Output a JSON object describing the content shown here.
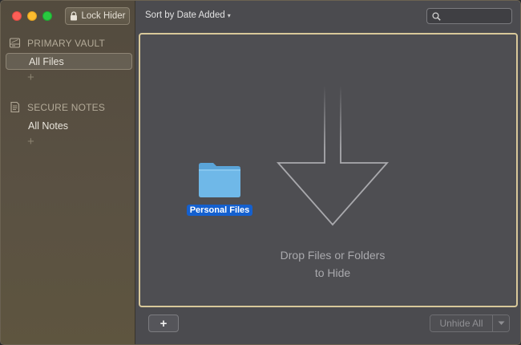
{
  "sidebar": {
    "lock_label": "Lock Hider",
    "sections": [
      {
        "title": "PRIMARY VAULT",
        "items": [
          "All Files"
        ],
        "icon": "drive-icon"
      },
      {
        "title": "SECURE NOTES",
        "items": [
          "All Notes"
        ],
        "icon": "notes-icon"
      }
    ],
    "add_symbol": "+"
  },
  "toolbar": {
    "sort_label": "Sort by Date Added",
    "sort_caret": "▾",
    "search_placeholder": ""
  },
  "drop_zone": {
    "folder_name": "Personal Files",
    "hint_line1": "Drop Files or Folders",
    "hint_line2": "to Hide"
  },
  "footer": {
    "add_symbol": "+",
    "unhide_label": "Unhide All"
  },
  "colors": {
    "accent_border": "#d8c89a",
    "selection_blue": "#1460cf",
    "folder_blue": "#6fb8e8"
  }
}
